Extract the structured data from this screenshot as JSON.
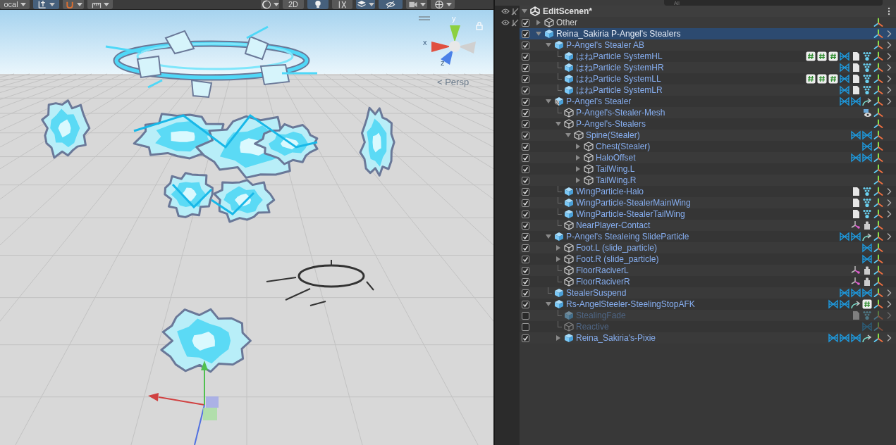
{
  "scene_toolbar": [
    {
      "kind": "dropdown",
      "label": "ocal",
      "selected": false
    },
    {
      "kind": "split",
      "selected": true
    },
    {
      "kind": "split",
      "selected": false
    },
    {
      "kind": "split",
      "selected": false
    },
    {
      "kind": "gap"
    },
    {
      "kind": "split",
      "selected": false
    },
    {
      "kind": "button",
      "label": "2D",
      "selected": false
    },
    {
      "kind": "button",
      "selected": true
    },
    {
      "kind": "button",
      "selected": false
    },
    {
      "kind": "split",
      "selected": true
    },
    {
      "kind": "button",
      "selected": true
    },
    {
      "kind": "split",
      "selected": false
    },
    {
      "kind": "split",
      "selected": false
    }
  ],
  "gizmo": {
    "axis_labels": [
      "y",
      "x",
      "z"
    ],
    "projection": "< Persp"
  },
  "hierarchy": {
    "search": {
      "placeholder": "All"
    },
    "scene": {
      "name": "EditScenen*",
      "expanded": true
    },
    "items": [
      {
        "name": "Other",
        "kind": "object",
        "checked": true,
        "selected": false,
        "toggles_shown": true,
        "expanded": false,
        "components": [
          {
            "kind": "axes"
          }
        ]
      },
      {
        "name": "Reina_Sakiria P-Angel's Stealers",
        "kind": "prefab",
        "checked": true,
        "selected": true,
        "expanded": true,
        "components": [
          {
            "kind": "axes"
          }
        ],
        "open_arrow": true,
        "children": [
          {
            "name": "P-Angel's Stealer AB",
            "kind": "prefab",
            "checked": true,
            "selected": false,
            "expanded": true,
            "components": [
              {
                "kind": "axes"
              }
            ],
            "open_arrow": true,
            "children": [
              {
                "name": "はねParticle SystemHL",
                "kind": "prefab",
                "checked": true,
                "selected": false,
                "components": [
                  {
                    "kind": "script"
                  },
                  {
                    "kind": "script"
                  },
                  {
                    "kind": "script"
                  },
                  {
                    "kind": "cloth"
                  },
                  {
                    "kind": "file"
                  },
                  {
                    "kind": "emitter"
                  },
                  {
                    "kind": "axes"
                  }
                ],
                "open_arrow": true
              },
              {
                "name": "はねParticle SystemHR",
                "kind": "prefab",
                "checked": true,
                "selected": false,
                "components": [
                  {
                    "kind": "cloth"
                  },
                  {
                    "kind": "file"
                  },
                  {
                    "kind": "emitter"
                  },
                  {
                    "kind": "axes"
                  }
                ],
                "open_arrow": true
              },
              {
                "name": "はねParticle SystemLL",
                "kind": "prefab",
                "checked": true,
                "selected": false,
                "components": [
                  {
                    "kind": "script"
                  },
                  {
                    "kind": "script"
                  },
                  {
                    "kind": "script"
                  },
                  {
                    "kind": "cloth"
                  },
                  {
                    "kind": "file"
                  },
                  {
                    "kind": "emitter"
                  },
                  {
                    "kind": "axes"
                  }
                ],
                "open_arrow": true
              },
              {
                "name": "はねParticle SystemLR",
                "kind": "prefab",
                "checked": true,
                "selected": false,
                "components": [
                  {
                    "kind": "cloth"
                  },
                  {
                    "kind": "file"
                  },
                  {
                    "kind": "emitter"
                  },
                  {
                    "kind": "axes"
                  }
                ],
                "open_arrow": true
              }
            ]
          },
          {
            "name": "P-Angel's Stealer",
            "kind": "variant",
            "checked": true,
            "selected": false,
            "expanded": true,
            "components": [
              {
                "kind": "cloth"
              },
              {
                "kind": "cloth"
              },
              {
                "kind": "constraint"
              },
              {
                "kind": "axes"
              }
            ],
            "open_arrow": true,
            "children": [
              {
                "name": "P-Angel's-Stealer-Mesh",
                "kind": "prefab_child",
                "checked": true,
                "selected": false,
                "components": [
                  {
                    "kind": "mesh"
                  },
                  {
                    "kind": "axes"
                  }
                ]
              },
              {
                "name": "P-Angel's-Stealers",
                "kind": "prefab_child",
                "checked": true,
                "selected": false,
                "expanded": true,
                "components": [
                  {
                    "kind": "axes"
                  }
                ],
                "children": [
                  {
                    "name": "Spine(Stealer)",
                    "kind": "prefab_child",
                    "checked": true,
                    "selected": false,
                    "expanded": true,
                    "components": [
                      {
                        "kind": "cloth"
                      },
                      {
                        "kind": "cloth"
                      },
                      {
                        "kind": "axes"
                      }
                    ],
                    "children": [
                      {
                        "name": "Chest(Stealer)",
                        "kind": "prefab_child",
                        "checked": true,
                        "selected": false,
                        "expanded": false,
                        "components": [
                          {
                            "kind": "cloth"
                          },
                          {
                            "kind": "axes"
                          }
                        ]
                      },
                      {
                        "name": "HaloOffset",
                        "kind": "prefab_child",
                        "checked": true,
                        "selected": false,
                        "expanded": false,
                        "components": [
                          {
                            "kind": "cloth"
                          },
                          {
                            "kind": "cloth"
                          },
                          {
                            "kind": "axes"
                          }
                        ]
                      },
                      {
                        "name": "TailWing.L",
                        "kind": "prefab_child",
                        "checked": true,
                        "selected": false,
                        "expanded": false,
                        "components": [
                          {
                            "kind": "axes"
                          }
                        ]
                      },
                      {
                        "name": "TailWing.R",
                        "kind": "prefab_child",
                        "checked": true,
                        "selected": false,
                        "expanded": false,
                        "components": [
                          {
                            "kind": "axes"
                          }
                        ]
                      }
                    ]
                  }
                ]
              },
              {
                "name": "WingParticle-Halo",
                "kind": "prefab",
                "checked": true,
                "selected": false,
                "components": [
                  {
                    "kind": "file"
                  },
                  {
                    "kind": "emitter"
                  },
                  {
                    "kind": "axes"
                  }
                ],
                "open_arrow": true
              },
              {
                "name": "WingParticle-StealerMainWing",
                "kind": "prefab",
                "checked": true,
                "selected": false,
                "components": [
                  {
                    "kind": "file"
                  },
                  {
                    "kind": "emitter"
                  },
                  {
                    "kind": "axes"
                  }
                ],
                "open_arrow": true
              },
              {
                "name": "WingParticle-StealerTailWing",
                "kind": "prefab",
                "checked": true,
                "selected": false,
                "components": [
                  {
                    "kind": "file"
                  },
                  {
                    "kind": "emitter"
                  },
                  {
                    "kind": "axes"
                  }
                ],
                "open_arrow": true
              },
              {
                "name": "NearPlayer-Contact",
                "kind": "prefab_child",
                "checked": true,
                "selected": false,
                "components": [
                  {
                    "kind": "contact"
                  },
                  {
                    "kind": "puzzle"
                  },
                  {
                    "kind": "axes"
                  }
                ]
              }
            ]
          },
          {
            "name": "P-Angel's Stealeing SlideParticle",
            "kind": "prefab",
            "checked": true,
            "selected": false,
            "expanded": true,
            "components": [
              {
                "kind": "cloth"
              },
              {
                "kind": "cloth"
              },
              {
                "kind": "constraint"
              },
              {
                "kind": "axes"
              }
            ],
            "open_arrow": true,
            "children": [
              {
                "name": "Foot.L (slide_particle)",
                "kind": "prefab_child",
                "checked": true,
                "selected": false,
                "expanded": false,
                "components": [
                  {
                    "kind": "cloth"
                  },
                  {
                    "kind": "axes"
                  }
                ]
              },
              {
                "name": "Foot.R (slide_particle)",
                "kind": "prefab_child",
                "checked": true,
                "selected": false,
                "expanded": false,
                "components": [
                  {
                    "kind": "cloth"
                  },
                  {
                    "kind": "axes"
                  }
                ]
              },
              {
                "name": "FloorRaciverL",
                "kind": "prefab_child",
                "checked": true,
                "selected": false,
                "components": [
                  {
                    "kind": "contact"
                  },
                  {
                    "kind": "puzzle"
                  },
                  {
                    "kind": "axes"
                  }
                ]
              },
              {
                "name": "FloorRaciverR",
                "kind": "prefab_child",
                "checked": true,
                "selected": false,
                "components": [
                  {
                    "kind": "contact"
                  },
                  {
                    "kind": "puzzle"
                  },
                  {
                    "kind": "axes"
                  }
                ]
              }
            ]
          },
          {
            "name": "StealerSuspend",
            "kind": "prefab",
            "checked": true,
            "selected": false,
            "components": [
              {
                "kind": "cloth"
              },
              {
                "kind": "cloth"
              },
              {
                "kind": "cloth"
              },
              {
                "kind": "axes"
              }
            ],
            "open_arrow": true
          },
          {
            "name": "Rs-AngelSteeler-SteelingStopAFK",
            "kind": "prefab",
            "checked": true,
            "selected": false,
            "expanded": true,
            "components": [
              {
                "kind": "cloth"
              },
              {
                "kind": "cloth"
              },
              {
                "kind": "constraint"
              },
              {
                "kind": "script"
              },
              {
                "kind": "axes"
              }
            ],
            "open_arrow": true,
            "children": [
              {
                "name": "StealingFade",
                "kind": "prefab",
                "checked": false,
                "selected": false,
                "components": [
                  {
                    "kind": "file"
                  },
                  {
                    "kind": "emitter"
                  },
                  {
                    "kind": "axes"
                  }
                ],
                "open_arrow": true
              },
              {
                "name": "Reactive",
                "kind": "prefab_child",
                "checked": false,
                "selected": false,
                "components": [
                  {
                    "kind": "cloth"
                  },
                  {
                    "kind": "axes"
                  }
                ]
              },
              {
                "name": "Reina_Sakiria's-Pixie",
                "kind": "prefab",
                "checked": true,
                "selected": false,
                "expanded": false,
                "components": [
                  {
                    "kind": "cloth"
                  },
                  {
                    "kind": "cloth"
                  },
                  {
                    "kind": "cloth"
                  },
                  {
                    "kind": "constraint"
                  },
                  {
                    "kind": "axes"
                  }
                ],
                "open_arrow": true
              }
            ]
          }
        ]
      }
    ]
  }
}
